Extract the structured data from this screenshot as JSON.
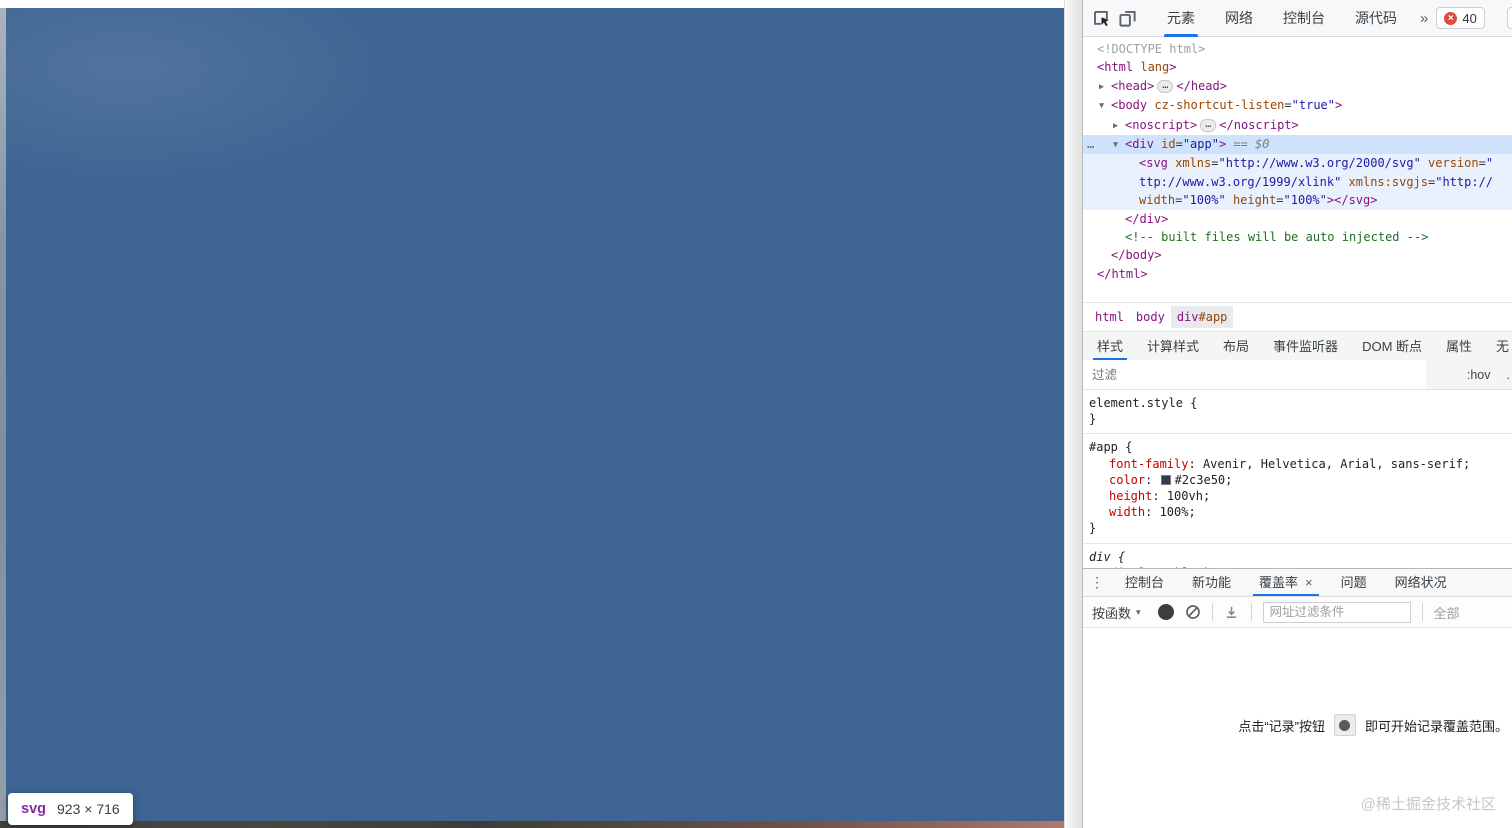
{
  "icons": {
    "menu": "⋮",
    "dropdown": "▾",
    "close": "×",
    "badge_x": "×",
    "overflow": "»"
  },
  "colors": {
    "accent_blue": "#1a73e8",
    "page_blue": "#3d6492",
    "tag_purple": "#881280",
    "attr_orange": "#994500",
    "value_blue": "#1a1aa6",
    "comment_green": "#236e25",
    "property_red": "#c80000",
    "error_red": "#df4b44",
    "swatch_color": "#2c3e50"
  },
  "page": {
    "tooltip_tag": "svg",
    "tooltip_dims": "923 × 716"
  },
  "toolbar": {
    "tabs": [
      {
        "label": "元素",
        "active": true
      },
      {
        "label": "网络",
        "active": false
      },
      {
        "label": "控制台",
        "active": false
      },
      {
        "label": "源代码",
        "active": false
      }
    ],
    "overflow_symbol": "»",
    "error_count": "40"
  },
  "dom_tree": [
    {
      "indent": 0,
      "tokens": [
        [
          "doctype",
          "<!DOCTYPE html>"
        ]
      ]
    },
    {
      "indent": 0,
      "tokens": [
        [
          "tag",
          "<html"
        ],
        [
          "attr",
          " lang"
        ],
        [
          "tag",
          ">"
        ]
      ]
    },
    {
      "indent": 1,
      "arrow": "▶",
      "tokens": [
        [
          "tag",
          "<head>"
        ],
        [
          "dots",
          "…"
        ],
        [
          "tag",
          "</head>"
        ]
      ]
    },
    {
      "indent": 1,
      "arrow": "▼",
      "tokens": [
        [
          "tag",
          "<body"
        ],
        [
          "attr",
          " cz-shortcut-listen"
        ],
        [
          "plain",
          "="
        ],
        [
          "val",
          "\"true\""
        ],
        [
          "tag",
          ">"
        ]
      ]
    },
    {
      "indent": 2,
      "arrow": "▶",
      "tokens": [
        [
          "tag",
          "<noscript>"
        ],
        [
          "dots",
          "…"
        ],
        [
          "tag",
          "</noscript>"
        ]
      ]
    },
    {
      "indent": 2,
      "arrow": "▼",
      "hl": "sel",
      "gutter": "…",
      "tokens": [
        [
          "tag",
          "<div"
        ],
        [
          "attr",
          " id"
        ],
        [
          "plain",
          "="
        ],
        [
          "val",
          "\"app\""
        ],
        [
          "tag",
          ">"
        ],
        [
          "hint",
          " == $0"
        ]
      ]
    },
    {
      "indent": 3,
      "hl": "child",
      "tokens": [
        [
          "tag",
          "<svg"
        ],
        [
          "attr",
          " xmlns"
        ],
        [
          "plain",
          "="
        ],
        [
          "val",
          "\"http://www.w3.org/2000/svg\""
        ],
        [
          "attr",
          " version"
        ],
        [
          "plain",
          "="
        ],
        [
          "val",
          "\""
        ]
      ]
    },
    {
      "indent": 3,
      "hl": "child",
      "tokens": [
        [
          "val",
          "ttp://www.w3.org/1999/xlink\""
        ],
        [
          "attr",
          " xmlns:svgjs"
        ],
        [
          "plain",
          "="
        ],
        [
          "val",
          "\"http://"
        ]
      ]
    },
    {
      "indent": 3,
      "hl": "child",
      "tokens": [
        [
          "attr",
          "width"
        ],
        [
          "plain",
          "="
        ],
        [
          "val",
          "\"100%\""
        ],
        [
          "attr",
          " height"
        ],
        [
          "plain",
          "="
        ],
        [
          "val",
          "\"100%\""
        ],
        [
          "tag",
          "></svg>"
        ]
      ]
    },
    {
      "indent": 2,
      "tokens": [
        [
          "tag",
          "</div>"
        ]
      ]
    },
    {
      "indent": 2,
      "tokens": [
        [
          "comment",
          "<!-- built files will be auto injected -->"
        ]
      ]
    },
    {
      "indent": 1,
      "tokens": [
        [
          "tag",
          "</body>"
        ]
      ]
    },
    {
      "indent": 0,
      "tokens": [
        [
          "tag",
          "</html>"
        ]
      ]
    }
  ],
  "breadcrumbs": [
    {
      "parts": [
        [
          "tag",
          "html"
        ]
      ],
      "selected": false
    },
    {
      "parts": [
        [
          "tag",
          "body"
        ]
      ],
      "selected": false
    },
    {
      "parts": [
        [
          "tag",
          "div"
        ],
        [
          "attr",
          "#app"
        ]
      ],
      "selected": true
    }
  ],
  "styles_tabs": [
    {
      "label": "样式",
      "active": true
    },
    {
      "label": "计算样式",
      "active": false
    },
    {
      "label": "布局",
      "active": false
    },
    {
      "label": "事件监听器",
      "active": false
    },
    {
      "label": "DOM 断点",
      "active": false
    },
    {
      "label": "属性",
      "active": false
    },
    {
      "label": "无",
      "active": false
    }
  ],
  "style_filter": {
    "placeholder": "过滤",
    "pseudo": ":hov",
    "cls": "."
  },
  "css_sections": [
    {
      "italic": false,
      "lines": [
        [
          [
            "sel",
            "element.style"
          ],
          [
            "brace",
            " {"
          ]
        ],
        [
          [
            "brace",
            "}"
          ]
        ]
      ]
    },
    {
      "italic": false,
      "lines": [
        [
          [
            "sel",
            "#app"
          ],
          [
            "brace",
            " {"
          ]
        ],
        [
          [
            "prop",
            "font-family"
          ],
          [
            "plain",
            ": "
          ],
          [
            "val",
            "Avenir, Helvetica, Arial, sans-serif"
          ],
          [
            "plain",
            ";"
          ]
        ],
        [
          [
            "prop",
            "color"
          ],
          [
            "plain",
            ": "
          ],
          [
            "swatch",
            ""
          ],
          [
            "val",
            "#2c3e50"
          ],
          [
            "plain",
            ";"
          ]
        ],
        [
          [
            "prop",
            "height"
          ],
          [
            "plain",
            ": "
          ],
          [
            "val",
            "100vh"
          ],
          [
            "plain",
            ";"
          ]
        ],
        [
          [
            "prop",
            "width"
          ],
          [
            "plain",
            ": "
          ],
          [
            "val",
            "100%"
          ],
          [
            "plain",
            ";"
          ]
        ],
        [
          [
            "brace",
            "}"
          ]
        ]
      ]
    },
    {
      "italic": true,
      "lines": [
        [
          [
            "sel",
            "div"
          ],
          [
            "brace",
            " {"
          ]
        ],
        [
          [
            "prop",
            "display"
          ],
          [
            "plain",
            ": "
          ],
          [
            "val",
            "block"
          ],
          [
            "plain",
            ";"
          ]
        ]
      ]
    }
  ],
  "drawer": {
    "tabs": [
      {
        "label": "控制台",
        "active": false,
        "closable": false
      },
      {
        "label": "新功能",
        "active": false,
        "closable": false
      },
      {
        "label": "覆盖率",
        "active": true,
        "closable": true
      },
      {
        "label": "问题",
        "active": false,
        "closable": false
      },
      {
        "label": "网络状况",
        "active": false,
        "closable": false
      }
    ],
    "toolbar": {
      "scope_label": "按函数",
      "url_placeholder": "网址过滤条件",
      "type_filter": "全部"
    },
    "empty_message": {
      "prefix": "点击“记录”按钮",
      "suffix": "即可开始记录覆盖范围。"
    },
    "watermark": "@稀土掘金技术社区"
  }
}
